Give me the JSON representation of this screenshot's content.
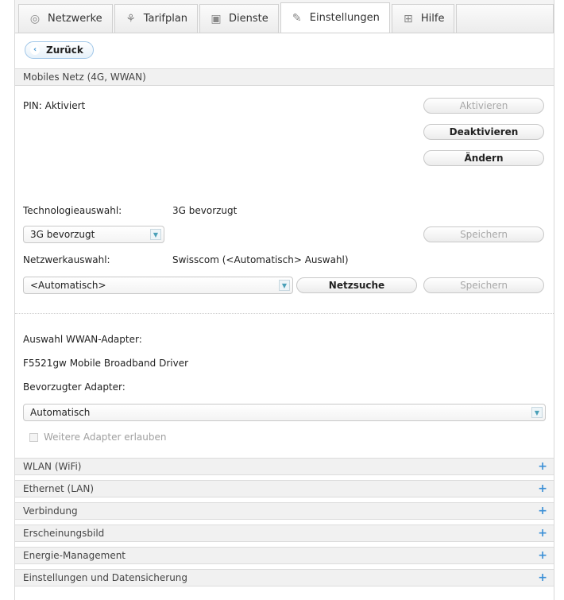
{
  "tabs": [
    {
      "label": "Netzwerke",
      "icon": "network-icon"
    },
    {
      "label": "Tarifplan",
      "icon": "tariff-icon"
    },
    {
      "label": "Dienste",
      "icon": "gift-icon"
    },
    {
      "label": "Einstellungen",
      "icon": "wrench-icon"
    },
    {
      "label": "Hilfe",
      "icon": "help-icon"
    }
  ],
  "back_button": "Zurück",
  "mobile_section": {
    "title": "Mobiles Netz (4G, WWAN)",
    "pin_label": "PIN: Aktiviert",
    "btn_activate": "Aktivieren",
    "btn_deactivate": "Deaktivieren",
    "btn_change": "Ändern",
    "tech_label": "Technologieauswahl:",
    "tech_value": "3G bevorzugt",
    "tech_select": "3G bevorzugt",
    "save_label": "Speichern",
    "network_label": "Netzwerkauswahl:",
    "network_value": "Swisscom (<Automatisch> Auswahl)",
    "network_select": "<Automatisch>",
    "search_button": "Netzsuche",
    "save_label2": "Speichern",
    "adapter_label": "Auswahl WWAN-Adapter:",
    "adapter_value": "F5521gw Mobile Broadband Driver",
    "preferred_label": "Bevorzugter Adapter:",
    "preferred_select": "Automatisch",
    "allow_more_label": "Weitere Adapter erlauben"
  },
  "sections": [
    {
      "label": "WLAN (WiFi)"
    },
    {
      "label": "Ethernet (LAN)"
    },
    {
      "label": "Verbindung"
    },
    {
      "label": "Erscheinungsbild"
    },
    {
      "label": "Energie-Management"
    },
    {
      "label": "Einstellungen und Datensicherung"
    }
  ],
  "plus_symbol": "+",
  "colors": {
    "accent": "#3a8fd6",
    "back_border": "#9fc6e8"
  }
}
